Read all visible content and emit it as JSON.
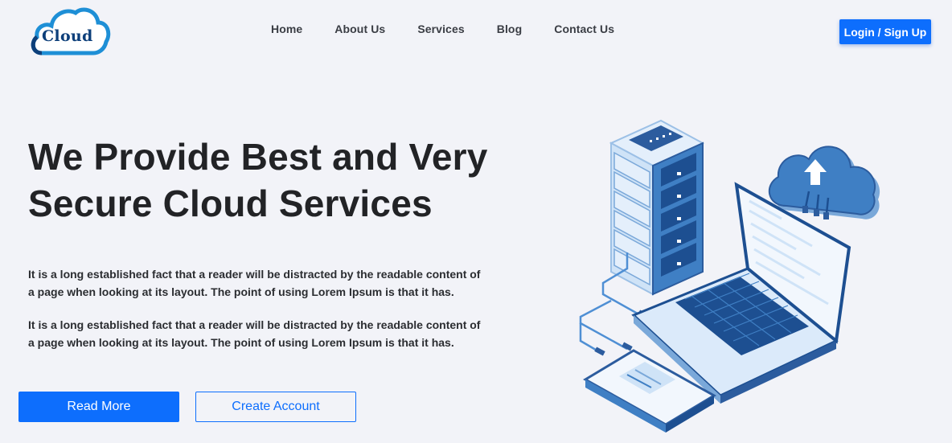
{
  "logo": {
    "text": "Cloud",
    "icon": "cloud-logo-icon"
  },
  "nav": {
    "items": [
      {
        "label": "Home"
      },
      {
        "label": "About Us"
      },
      {
        "label": "Services"
      },
      {
        "label": "Blog"
      },
      {
        "label": "Contact Us"
      }
    ]
  },
  "header": {
    "login_label": "Login / Sign Up"
  },
  "hero": {
    "title_line1": "We Provide Best and Very",
    "title_line2": "Secure Cloud Services",
    "paragraph1": "It is a long established fact that a reader will be distracted by the readable content of a page when looking at its layout. The point of using Lorem Ipsum is that it has.",
    "paragraph2": "It is a long established fact that a reader will be distracted by the readable content of a page when looking at its layout. The point of using Lorem Ipsum is that it has.",
    "read_more_label": "Read More",
    "create_account_label": "Create Account"
  },
  "illustration": {
    "icon": "cloud-server-laptop-illustration"
  },
  "colors": {
    "accent": "#0d6efd",
    "background": "#f2f3f8",
    "illustration_dark": "#1d4f91",
    "illustration_mid": "#3f7fc4",
    "illustration_light": "#cfe3f7"
  }
}
